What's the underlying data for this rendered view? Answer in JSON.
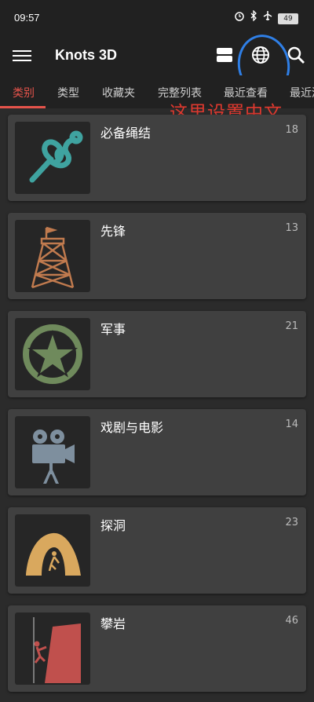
{
  "status_bar": {
    "time": "09:57",
    "battery": "49"
  },
  "app_bar": {
    "title": "Knots 3D"
  },
  "tabs": [
    {
      "label": "类别"
    },
    {
      "label": "类型"
    },
    {
      "label": "收藏夹"
    },
    {
      "label": "完整列表"
    },
    {
      "label": "最近查看"
    },
    {
      "label": "最近添"
    }
  ],
  "annotation": {
    "text": "这里设置中文",
    "color": "#e0392f",
    "circle_color": "#2f7fe6"
  },
  "categories": [
    {
      "title": "必备绳结",
      "count": "18",
      "icon": "knot-icon"
    },
    {
      "title": "先锋",
      "count": "13",
      "icon": "watchtower-icon"
    },
    {
      "title": "军事",
      "count": "21",
      "icon": "military-star-icon"
    },
    {
      "title": "戏剧与电影",
      "count": "14",
      "icon": "movie-camera-icon"
    },
    {
      "title": "探洞",
      "count": "23",
      "icon": "cave-icon"
    },
    {
      "title": "攀岩",
      "count": "46",
      "icon": "climber-icon"
    }
  ],
  "colors": {
    "accent": "#e5534b",
    "card_bg": "#404040",
    "background": "#2b2b2b"
  }
}
